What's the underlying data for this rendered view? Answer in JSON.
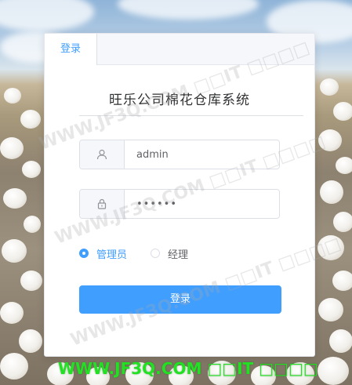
{
  "login_tab": {
    "label": "登录"
  },
  "system_title": "旺乐公司棉花仓库系统",
  "username": {
    "value": "admin",
    "icon": "user-icon"
  },
  "password": {
    "value": "••••••",
    "icon": "lock-icon"
  },
  "roles": [
    {
      "label": "管理员",
      "selected": true
    },
    {
      "label": "经理",
      "selected": false
    }
  ],
  "submit_label": "登录",
  "footer_watermark": "WWW.JF3Q.COM □□IT □□□□",
  "diagonal_watermark": "WWW.JF3Q.COM □□IT □□□□",
  "colors": {
    "accent": "#409eff",
    "watermark_green": "#22e022"
  }
}
